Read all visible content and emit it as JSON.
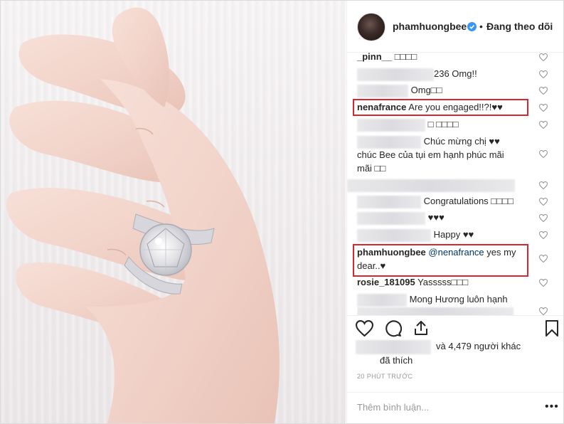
{
  "post": {
    "username": "phamhuongbee",
    "verified_icon": "verified-badge-icon",
    "separator": "•",
    "follow_status": "Đang theo dõi"
  },
  "comments": [
    {
      "user": "_pinn__",
      "text": "□□□□"
    },
    {
      "user": "",
      "text": "236 Omg!!"
    },
    {
      "user": "",
      "text": "Omg□□"
    },
    {
      "user": "nenafrance",
      "text": "Are you engaged!!?!♥♥"
    },
    {
      "user": "",
      "text": "□ □□□□"
    },
    {
      "user": "",
      "text": "Chúc mừng chị ♥♥"
    },
    {
      "user": "",
      "text": "chúc Bee của tụi em hạnh phúc mãi"
    },
    {
      "user": "",
      "text": "mãi □□"
    },
    {
      "user": "",
      "text": ""
    },
    {
      "user": "",
      "text": "Congratulations □□□□"
    },
    {
      "user": "",
      "text": "♥♥♥"
    },
    {
      "user": "",
      "text": "Happy ♥♥"
    },
    {
      "user": "phamhuongbee",
      "mention": "@nenafrance",
      "text": "yes my"
    },
    {
      "user": "",
      "text": "dear..♥"
    },
    {
      "user": "rosie_181095",
      "text": "Yasssss□□□"
    },
    {
      "user": "",
      "text": "Mong Hương luôn hạnh"
    }
  ],
  "likes": {
    "line1": "và 4,479 người khác",
    "line2": "đã thích"
  },
  "timestamp": "20 PHÚT TRƯỚC",
  "add_comment_placeholder": "Thêm bình luận...",
  "more_options": "•••",
  "icons": {
    "like": "heart-outline-icon",
    "comment": "comment-bubble-icon",
    "share": "share-icon",
    "save": "bookmark-icon"
  },
  "colors": {
    "highlight_box": "#d8262e",
    "verified": "#3897f0",
    "mention": "#003569"
  }
}
